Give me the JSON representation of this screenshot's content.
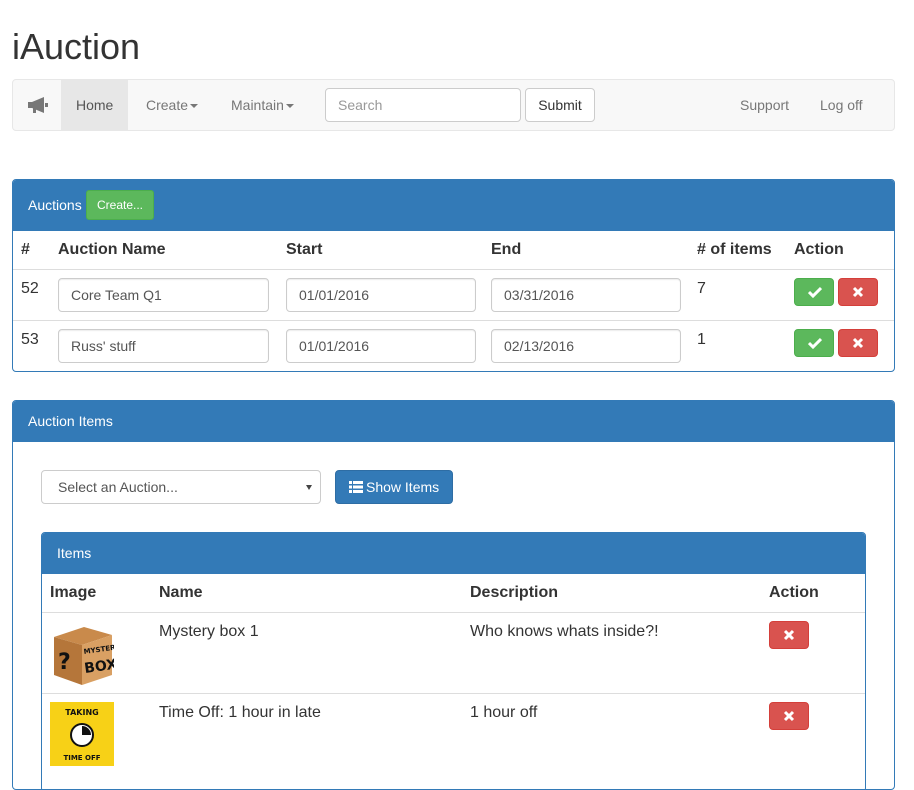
{
  "app": {
    "title": "iAuction"
  },
  "nav": {
    "brand_icon": "megaphone-icon",
    "home": "Home",
    "create": "Create",
    "maintain": "Maintain",
    "search_placeholder": "Search",
    "submit": "Submit",
    "support": "Support",
    "logoff": "Log off"
  },
  "auctions": {
    "title": "Auctions",
    "create_button": "Create...",
    "headers": {
      "id": "#",
      "name": "Auction Name",
      "start": "Start",
      "end": "End",
      "items": "# of items",
      "action": "Action"
    },
    "rows": [
      {
        "id": "52",
        "name": "Core Team Q1",
        "start": "01/01/2016",
        "end": "03/31/2016",
        "items": "7"
      },
      {
        "id": "53",
        "name": "Russ' stuff",
        "start": "01/01/2016",
        "end": "02/13/2016",
        "items": "1"
      }
    ]
  },
  "auction_items": {
    "title": "Auction Items",
    "select_placeholder": "Select an Auction...",
    "show_items": "Show Items",
    "items_panel_title": "Items",
    "headers": {
      "image": "Image",
      "name": "Name",
      "description": "Description",
      "action": "Action"
    },
    "rows": [
      {
        "image": "mystery-box-image",
        "name": "Mystery box 1",
        "description": "Who knows whats inside?!"
      },
      {
        "image": "time-off-image",
        "name": "Time Off: 1 hour in late",
        "description": "1 hour off"
      }
    ],
    "image_text": {
      "mystery_top": "MYSTERY",
      "mystery_bottom": "BOX",
      "timeoff_top": "TAKING",
      "timeoff_bottom": "TIME OFF"
    }
  },
  "colors": {
    "primary": "#337ab7",
    "success": "#5cb85c",
    "danger": "#d9534f",
    "navbar": "#f8f8f8",
    "timeoff_bg": "#f7d117"
  }
}
